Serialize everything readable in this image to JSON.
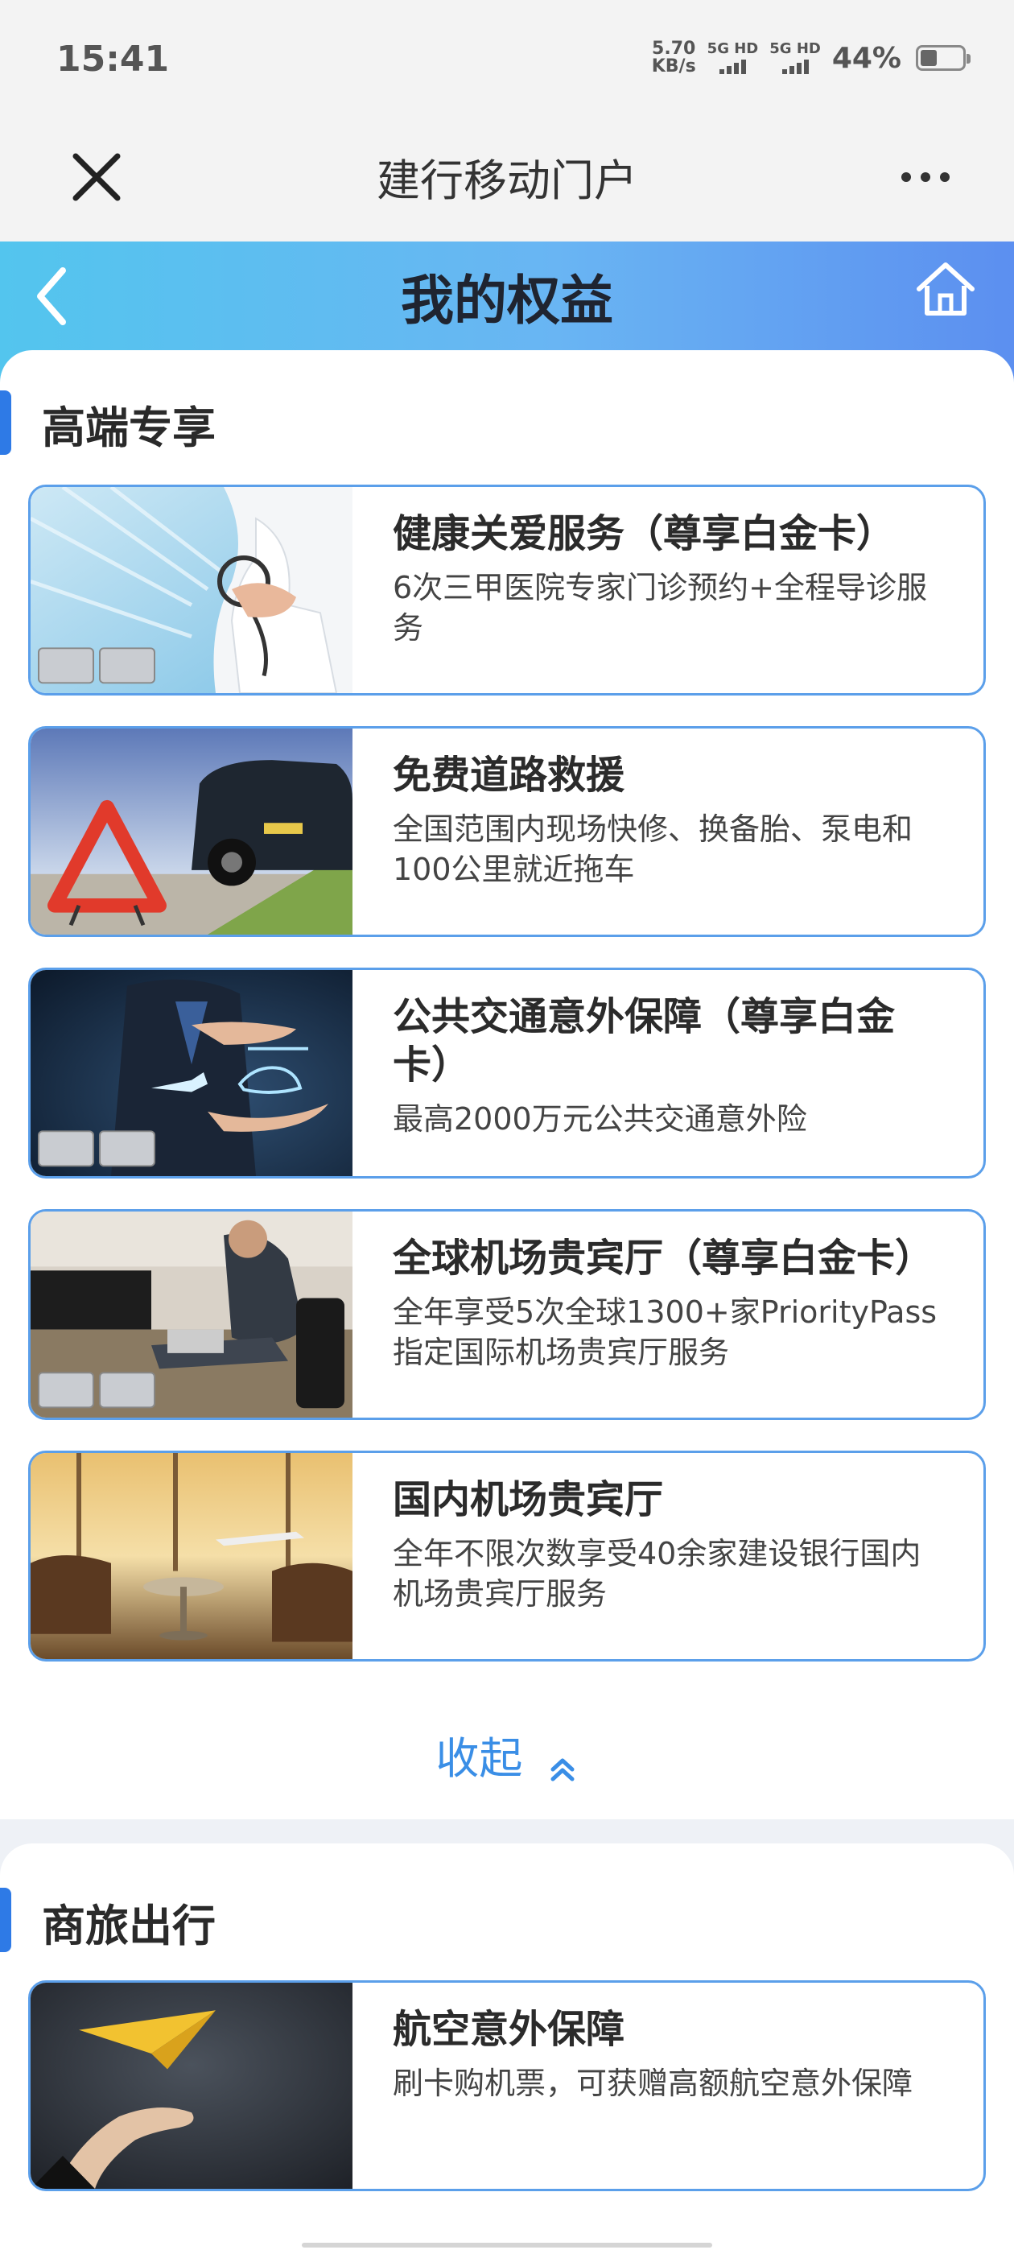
{
  "status_bar": {
    "time": "15:41",
    "net_speed_value": "5.70",
    "net_speed_unit": "KB/s",
    "sim1_label": "5G HD",
    "sim2_label": "5G HD",
    "battery_percent": "44%",
    "battery_level": 0.44
  },
  "nav_bar": {
    "title": "建行移动门户",
    "close_icon": "close-icon",
    "more_icon": "more-icon"
  },
  "page_header": {
    "title": "我的权益",
    "back_icon": "chevron-left-icon",
    "home_icon": "home-icon"
  },
  "sections": [
    {
      "title": "高端专享",
      "items": [
        {
          "title": "健康关爱服务（尊享白金卡）",
          "desc": "6次三甲医院专家门诊预约+全程导诊服务"
        },
        {
          "title": "免费道路救援",
          "desc": "全国范围内现场快修、换备胎、泵电和100公里就近拖车"
        },
        {
          "title": "公共交通意外保障（尊享白金卡）",
          "desc": "最高2000万元公共交通意外险"
        },
        {
          "title": "全球机场贵宾厅（尊享白金卡）",
          "desc": "全年享受5次全球1300+家PriorityPass指定国际机场贵宾厅服务"
        },
        {
          "title": "国内机场贵宾厅",
          "desc": "全年不限次数享受40余家建设银行国内机场贵宾厅服务"
        }
      ],
      "collapse_label": "收起"
    },
    {
      "title": "商旅出行",
      "items": [
        {
          "title": "航空意外保障",
          "desc": "刷卡购机票，可获赠高额航空意外保障"
        }
      ]
    }
  ],
  "colors": {
    "accent": "#2e7ae6",
    "card_border": "#5b9fea",
    "header_gradient_start": "#53c5ee",
    "header_gradient_end": "#5c8ff0"
  }
}
